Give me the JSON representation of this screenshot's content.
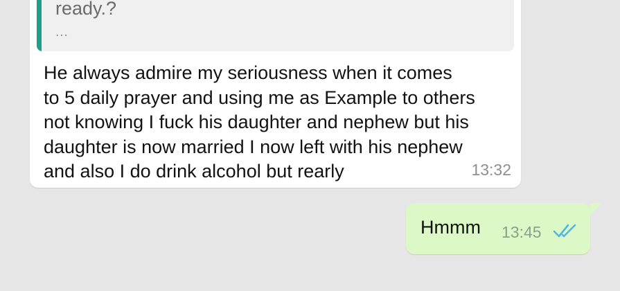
{
  "incoming": {
    "quote_text": "ready.?",
    "quote_more": "...",
    "message": "He always admire my seriousness when it comes\nto 5 daily prayer and using me as Example to others\nnot knowing I fuck his daughter and nephew but his\ndaughter is now married I now left with his  nephew\nand also I do drink alcohol but rearly",
    "time": "13:32"
  },
  "outgoing": {
    "message": "Hmmm",
    "time": "13:45",
    "status_icon": "double-check-read-icon"
  },
  "colors": {
    "background": "#e6e6e6",
    "incoming_bubble": "#ffffff",
    "outgoing_bubble": "#dcf8c6",
    "quote_accent": "#1f9e8a",
    "read_ticks": "#4fb6ec"
  }
}
